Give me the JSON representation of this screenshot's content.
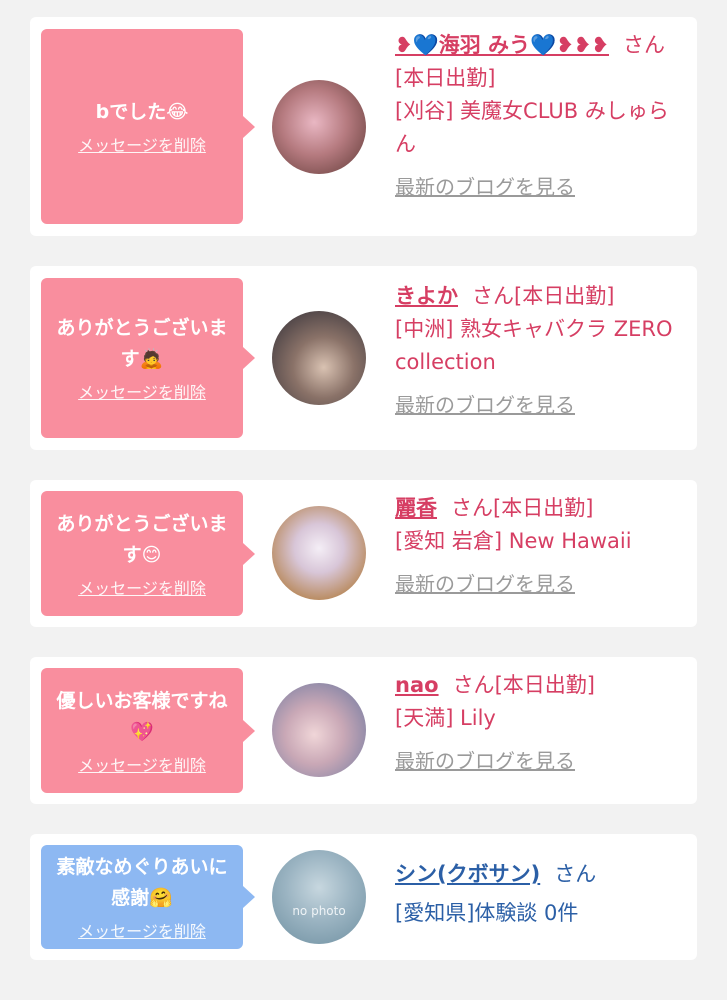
{
  "delete_label": "メッセージを削除",
  "blog_label": "最新のブログを見る",
  "cards": [
    {
      "message": "bでした😂",
      "name": "❥💙海羽 みう💙❥❥❥",
      "suffix": "さん",
      "status": "[本日出勤]",
      "shop": "[刈谷] 美魔女CLUB みしゅらん",
      "avatar_icon": "profile-photo-woman",
      "avatar_colors": [
        "#7a4a46",
        "#e9b7c3"
      ]
    },
    {
      "message": "ありがとうございます🙇",
      "name": "きよか",
      "suffix": "さん",
      "status": "[本日出勤]",
      "shop": "[中洲] 熟女キャバクラ ZERO collection",
      "avatar_icon": "profile-photo-woman",
      "avatar_colors": [
        "#3b3b44",
        "#c9b2a2"
      ]
    },
    {
      "message": "ありがとうございます😊",
      "name": "麗香",
      "suffix": "さん",
      "status": "[本日出勤]",
      "shop": "[愛知 岩倉] New Hawaii",
      "avatar_icon": "profile-photo-woman",
      "avatar_colors": [
        "#b98b60",
        "#e6d8e8"
      ]
    },
    {
      "message": "優しいお客様ですね💖",
      "name": "nao",
      "suffix": "さん",
      "status": "[本日出勤]",
      "shop": "[天満] Lily",
      "avatar_icon": "profile-photo-woman",
      "avatar_colors": [
        "#d9b9a6",
        "#a6c6e6"
      ]
    },
    {
      "message": "素敵なめぐりあいに感謝🤗",
      "name": "シン(クボサン)",
      "suffix": "さん",
      "shop": "[愛知県]体験談 0件",
      "avatar_icon": "no-photo-placeholder",
      "avatar_text": "no photo",
      "avatar_colors": [
        "#7fa0b0",
        "#c7d7df"
      ]
    }
  ]
}
